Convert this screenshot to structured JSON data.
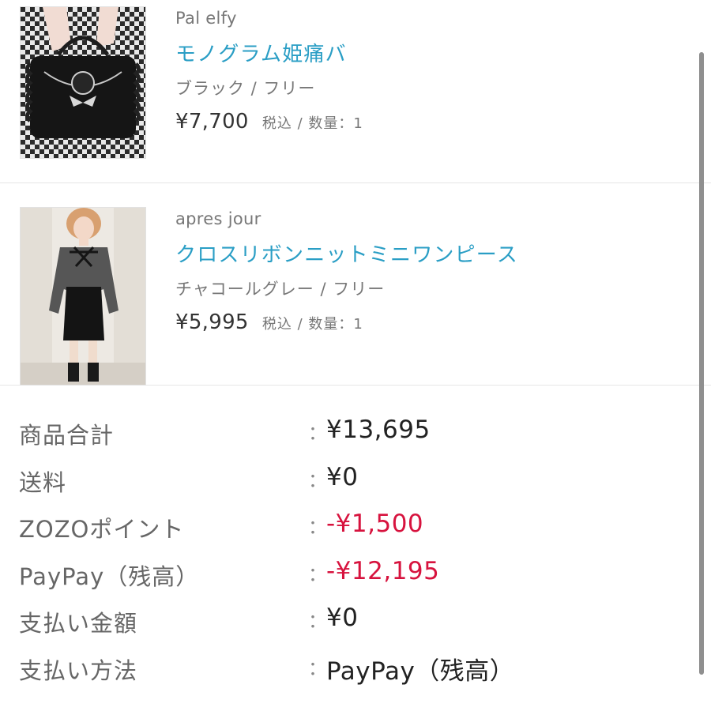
{
  "items": [
    {
      "brand": "Pal elfy",
      "name": "モノグラム姫痛バ",
      "variant": "ブラック / フリー",
      "price": "¥7,700",
      "tax_qty": "税込 / 数量：1"
    },
    {
      "brand": "apres jour",
      "name": "クロスリボンニットミニワンピース",
      "variant": "チャコールグレー / フリー",
      "price": "¥5,995",
      "tax_qty": "税込 / 数量：1"
    }
  ],
  "summary": {
    "colon": "：",
    "rows": [
      {
        "label": "商品合計",
        "value": "¥13,695"
      },
      {
        "label": "送料",
        "value": "¥0"
      },
      {
        "label": "ZOZOポイント",
        "value": "-¥1,500"
      },
      {
        "label": "PayPay（残高）",
        "value": "-¥12,195"
      },
      {
        "label": "支払い金額",
        "value": "¥0"
      },
      {
        "label": "支払い方法",
        "value": "PayPay（残高）"
      }
    ]
  },
  "colors": {
    "link": "#2a9ec5",
    "negative": "#d7133e"
  }
}
